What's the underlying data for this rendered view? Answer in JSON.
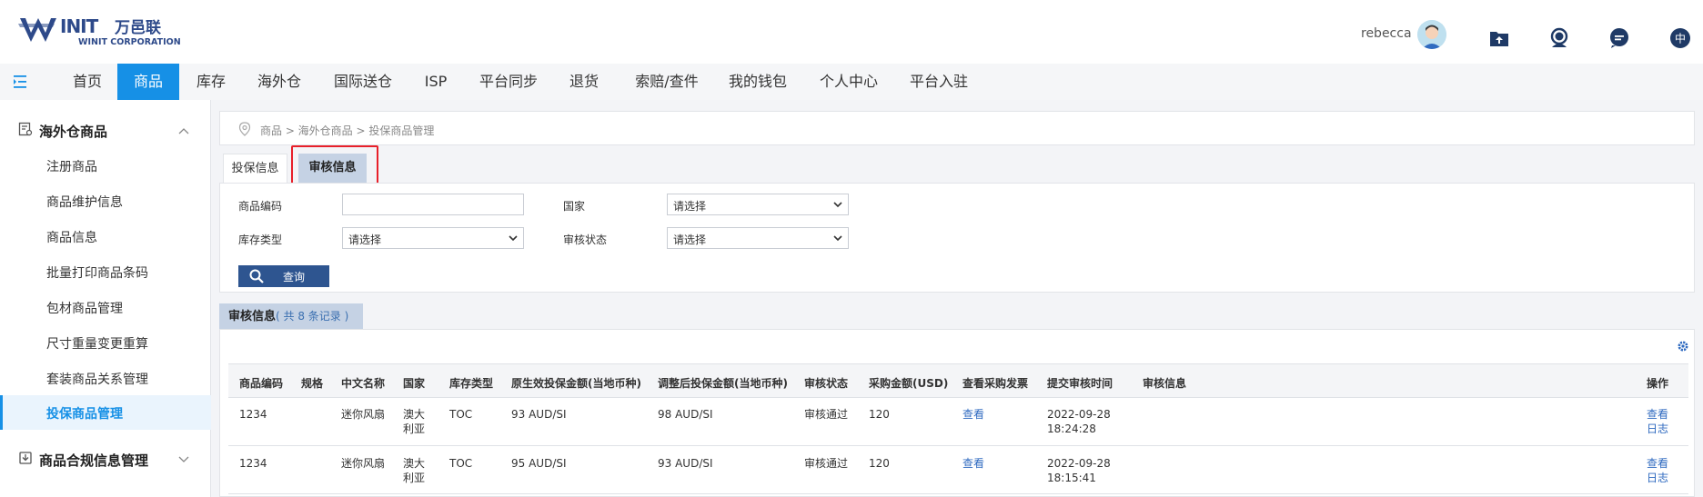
{
  "header": {
    "logo_text": "WINIT万邑联",
    "logo_sub": "WINIT CORPORATION",
    "username": "rebecca",
    "lang_label": "中",
    "colors": {
      "brand": "#2e4a8a",
      "accent": "#1690e6"
    }
  },
  "nav": {
    "items": [
      "首页",
      "商品",
      "库存",
      "海外仓",
      "国际送仓",
      "ISP",
      "平台同步",
      "退货",
      "索赔/查件",
      "我的钱包",
      "个人中心",
      "平台入驻"
    ],
    "active_index": 1
  },
  "sidebar": {
    "group1": "海外仓商品",
    "items": [
      "注册商品",
      "商品维护信息",
      "商品信息",
      "批量打印商品条码",
      "包材商品管理",
      "尺寸重量变更重算",
      "套装商品关系管理",
      "投保商品管理"
    ],
    "active_index": 7,
    "group2": "商品合规信息管理"
  },
  "breadcrumb": "商品 > 海外仓商品 > 投保商品管理",
  "tabs": [
    "投保信息",
    "审核信息"
  ],
  "filters": {
    "code_label": "商品编码",
    "code_value": "",
    "country_label": "国家",
    "country_value": "请选择",
    "stock_type_label": "库存类型",
    "stock_type_value": "请选择",
    "review_status_label": "审核状态",
    "review_status_value": "请选择",
    "query_button": "查询"
  },
  "result": {
    "title": "审核信息",
    "count_text": "( 共 8 条记录 )"
  },
  "table": {
    "columns": [
      "商品编码",
      "规格",
      "中文名称",
      "国家",
      "库存类型",
      "原生效投保金额(当地币种)",
      "调整后投保金额(当地币种)",
      "审核状态",
      "采购金额(USD)",
      "查看采购发票",
      "提交审核时间",
      "审核信息",
      "操作"
    ],
    "rows": [
      {
        "code": "1234",
        "spec": "",
        "name": "迷你风扇",
        "country_l1": "澳大",
        "country_l2": "利亚",
        "stock_type": "TOC",
        "orig_amount": "93 AUD/SI",
        "adj_amount": "98 AUD/SI",
        "status": "审核通过",
        "purchase": "120",
        "invoice": "查看",
        "date": "2022-09-28",
        "time": "18:24:28",
        "review_info": "",
        "op_view": "查看",
        "op_log": "日志"
      },
      {
        "code": "1234",
        "spec": "",
        "name": "迷你风扇",
        "country_l1": "澳大",
        "country_l2": "利亚",
        "stock_type": "TOC",
        "orig_amount": "95 AUD/SI",
        "adj_amount": "93 AUD/SI",
        "status": "审核通过",
        "purchase": "120",
        "invoice": "查看",
        "date": "2022-09-28",
        "time": "18:15:41",
        "review_info": "",
        "op_view": "查看",
        "op_log": "日志"
      }
    ]
  }
}
